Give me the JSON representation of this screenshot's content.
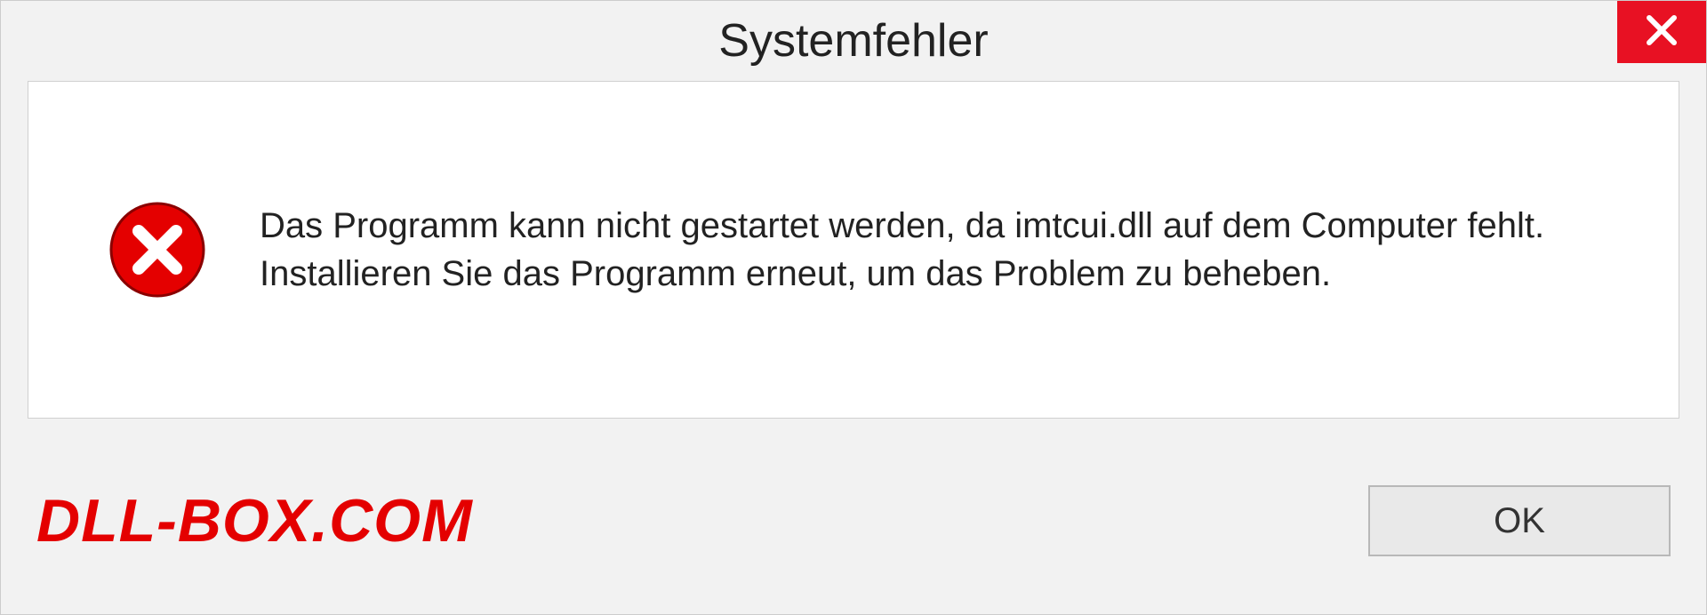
{
  "dialog": {
    "title": "Systemfehler",
    "message": "Das Programm kann nicht gestartet werden, da imtcui.dll auf dem Computer fehlt. Installieren Sie das Programm erneut, um das Problem zu beheben.",
    "ok_label": "OK"
  },
  "watermark": "DLL-BOX.COM",
  "colors": {
    "close_bg": "#e81123",
    "error_red": "#e40000",
    "panel_bg": "#ffffff",
    "dialog_bg": "#f2f2f2"
  }
}
